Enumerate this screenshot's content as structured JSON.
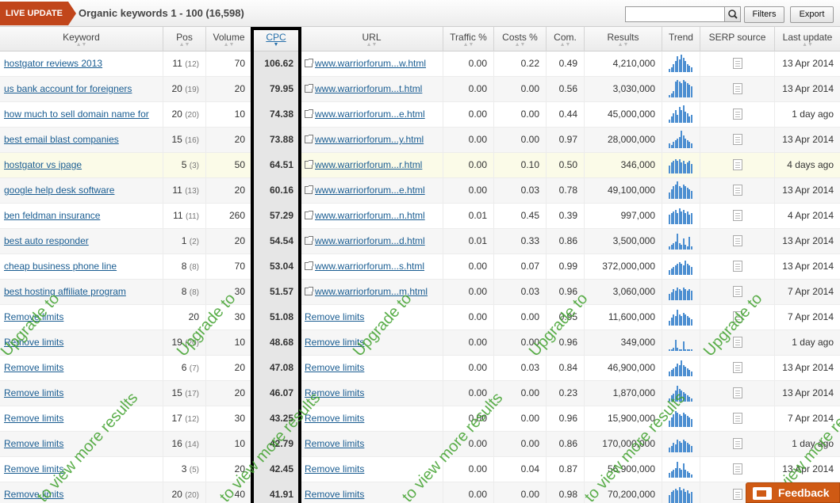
{
  "topbar": {
    "live_label": "LIVE UPDATE",
    "title": "Organic keywords 1 - 100 (16,598)",
    "search_value": "",
    "filters_label": "Filters",
    "export_label": "Export"
  },
  "columns": [
    "Keyword",
    "Pos",
    "Volume",
    "CPC",
    "URL",
    "Traffic %",
    "Costs %",
    "Com.",
    "Results",
    "Trend",
    "SERP source",
    "Last update"
  ],
  "rows": [
    {
      "kw": "hostgator reviews 2013",
      "pos": "11",
      "prev": "(12)",
      "vol": "70",
      "cpc": "106.62",
      "url": "www.warriorforum...w.html",
      "traffic": "0.00",
      "costs": "0.22",
      "com": "0.49",
      "results": "4,210,000",
      "date": "13 Apr 2014"
    },
    {
      "kw": "us bank account for foreigners",
      "pos": "20",
      "prev": "(19)",
      "vol": "20",
      "cpc": "79.95",
      "url": "www.warriorforum...t.html",
      "traffic": "0.00",
      "costs": "0.00",
      "com": "0.56",
      "results": "3,030,000",
      "date": "13 Apr 2014"
    },
    {
      "kw": "how much to sell domain name for",
      "pos": "20",
      "prev": "(20)",
      "vol": "10",
      "cpc": "74.38",
      "url": "www.warriorforum...e.html",
      "traffic": "0.00",
      "costs": "0.00",
      "com": "0.44",
      "results": "45,000,000",
      "date": "1 day ago"
    },
    {
      "kw": "best email blast companies",
      "pos": "15",
      "prev": "(16)",
      "vol": "20",
      "cpc": "73.88",
      "url": "www.warriorforum...y.html",
      "traffic": "0.00",
      "costs": "0.00",
      "com": "0.97",
      "results": "28,000,000",
      "date": "13 Apr 2014"
    },
    {
      "kw": "hostgator vs ipage",
      "pos": "5",
      "prev": "(3)",
      "vol": "50",
      "cpc": "64.51",
      "url": "www.warriorforum...r.html",
      "traffic": "0.00",
      "costs": "0.10",
      "com": "0.50",
      "results": "346,000",
      "date": "4 days ago"
    },
    {
      "kw": "google help desk software",
      "pos": "11",
      "prev": "(13)",
      "vol": "20",
      "cpc": "60.16",
      "url": "www.warriorforum...e.html",
      "traffic": "0.00",
      "costs": "0.03",
      "com": "0.78",
      "results": "49,100,000",
      "date": "13 Apr 2014"
    },
    {
      "kw": "ben feldman insurance",
      "pos": "11",
      "prev": "(11)",
      "vol": "260",
      "cpc": "57.29",
      "url": "www.warriorforum...n.html",
      "traffic": "0.01",
      "costs": "0.45",
      "com": "0.39",
      "results": "997,000",
      "date": "4 Apr 2014"
    },
    {
      "kw": "best auto responder",
      "pos": "1",
      "prev": "(2)",
      "vol": "20",
      "cpc": "54.54",
      "url": "www.warriorforum...d.html",
      "traffic": "0.01",
      "costs": "0.33",
      "com": "0.86",
      "results": "3,500,000",
      "date": "13 Apr 2014"
    },
    {
      "kw": "cheap business phone line",
      "pos": "8",
      "prev": "(8)",
      "vol": "70",
      "cpc": "53.04",
      "url": "www.warriorforum...s.html",
      "traffic": "0.00",
      "costs": "0.07",
      "com": "0.99",
      "results": "372,000,000",
      "date": "13 Apr 2014"
    },
    {
      "kw": "best hosting affiliate program",
      "pos": "8",
      "prev": "(8)",
      "vol": "30",
      "cpc": "51.57",
      "url": "www.warriorforum...m.html",
      "traffic": "0.00",
      "costs": "0.03",
      "com": "0.96",
      "results": "3,060,000",
      "date": "7 Apr 2014"
    },
    {
      "kw": "Remove limits",
      "pos": "20",
      "prev": "",
      "vol": "30",
      "cpc": "51.08",
      "url": "Remove limits",
      "traffic": "0.00",
      "costs": "0.00",
      "com": "0.95",
      "results": "11,600,000",
      "date": "7 Apr 2014"
    },
    {
      "kw": "Remove limits",
      "pos": "19",
      "prev": "(20)",
      "vol": "10",
      "cpc": "48.68",
      "url": "Remove limits",
      "traffic": "0.00",
      "costs": "0.00",
      "com": "0.96",
      "results": "349,000",
      "date": "1 day ago"
    },
    {
      "kw": "Remove limits",
      "pos": "6",
      "prev": "(7)",
      "vol": "20",
      "cpc": "47.08",
      "url": "Remove limits",
      "traffic": "0.00",
      "costs": "0.03",
      "com": "0.84",
      "results": "46,900,000",
      "date": "13 Apr 2014"
    },
    {
      "kw": "Remove limits",
      "pos": "15",
      "prev": "(17)",
      "vol": "20",
      "cpc": "46.07",
      "url": "Remove limits",
      "traffic": "0.00",
      "costs": "0.00",
      "com": "0.23",
      "results": "1,870,000",
      "date": "13 Apr 2014"
    },
    {
      "kw": "Remove limits",
      "pos": "17",
      "prev": "(12)",
      "vol": "30",
      "cpc": "43.25",
      "url": "Remove limits",
      "traffic": "0.00",
      "costs": "0.00",
      "com": "0.96",
      "results": "15,900,000",
      "date": "7 Apr 2014"
    },
    {
      "kw": "Remove limits",
      "pos": "16",
      "prev": "(14)",
      "vol": "10",
      "cpc": "42.79",
      "url": "Remove limits",
      "traffic": "0.00",
      "costs": "0.00",
      "com": "0.86",
      "results": "170,000,000",
      "date": "1 day ago"
    },
    {
      "kw": "Remove limits",
      "pos": "3",
      "prev": "(5)",
      "vol": "20",
      "cpc": "42.45",
      "url": "Remove limits",
      "traffic": "0.00",
      "costs": "0.04",
      "com": "0.87",
      "results": "56,900,000",
      "date": "13 Apr 2014"
    },
    {
      "kw": "Remove limits",
      "pos": "20",
      "prev": "(20)",
      "vol": "40",
      "cpc": "41.91",
      "url": "Remove limits",
      "traffic": "0.00",
      "costs": "0.00",
      "com": "0.98",
      "results": "70,200,000",
      "date": "13 Apr 2014"
    }
  ],
  "watermark": {
    "upgrade": "Upgrade to",
    "view_more": "to view more results"
  },
  "feedback_label": "Feedback",
  "colors": {
    "live_badge": "#c1461b",
    "link": "#1a5d92",
    "trend_bar": "#4d8fd1",
    "watermark": "#3fa12c",
    "feedback": "#cf5a14"
  }
}
